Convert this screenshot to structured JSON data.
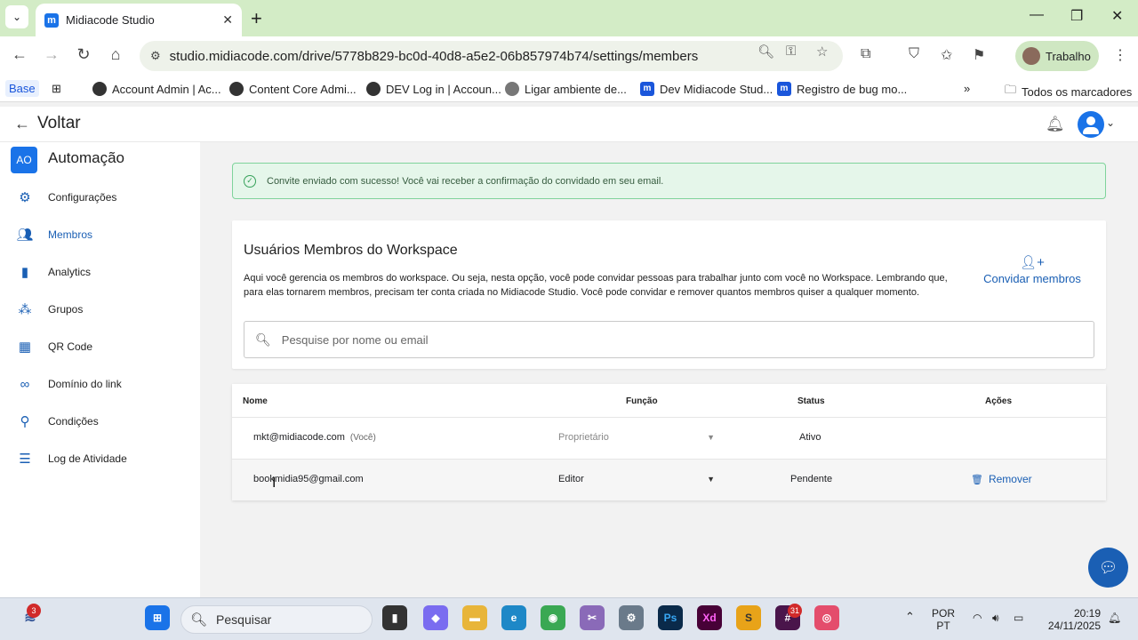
{
  "browser": {
    "tab_title": "Midiacode Studio",
    "tab_favicon": "m",
    "url": "studio.midiacode.com/drive/5778b829-bc0d-40d8-a5e2-06b857974b74/settings/members",
    "profile_label": "Trabalho",
    "bookmarks": [
      {
        "label": "Account Admin | Ac...",
        "icon": "globe-icon"
      },
      {
        "label": "Content Core Admi...",
        "icon": "globe-icon"
      },
      {
        "label": "DEV Log in | Accoun...",
        "icon": "globe-icon"
      },
      {
        "label": "Ligar ambiente de...",
        "icon": "gear-icon"
      },
      {
        "label": "Dev Midiacode Stud...",
        "icon": "midiacode-icon"
      },
      {
        "label": "Registro de bug mo...",
        "icon": "midiacode-icon"
      }
    ],
    "bookmarks_base": "Base",
    "all_bookmarks": "Todos os marcadores"
  },
  "header": {
    "back_label": "Voltar"
  },
  "sidebar": {
    "workspace_initials": "AO",
    "workspace_name": "Automação",
    "items": [
      {
        "label": "Configurações",
        "icon": "gear-icon"
      },
      {
        "label": "Membros",
        "icon": "people-icon",
        "active": true
      },
      {
        "label": "Analytics",
        "icon": "bar-chart-icon"
      },
      {
        "label": "Grupos",
        "icon": "groups-icon"
      },
      {
        "label": "QR Code",
        "icon": "qr-code-icon"
      },
      {
        "label": "Domínio do link",
        "icon": "link-icon"
      },
      {
        "label": "Condições",
        "icon": "conditions-icon"
      },
      {
        "label": "Log de Atividade",
        "icon": "list-icon"
      }
    ]
  },
  "alert": {
    "message": "Convite enviado com sucesso! Você vai receber a confirmação do convidado em seu email."
  },
  "members_card": {
    "title": "Usuários Membros do Workspace",
    "description": "Aqui você gerencia os membros do workspace. Ou seja, nesta opção, você pode convidar pessoas para trabalhar junto com você no Workspace. Lembrando que, para elas tornarem membros, precisam ter conta criada no Midiacode Studio. Você pode convidar e remover quantos membros quiser a qualquer momento.",
    "invite_label": "Convidar membros",
    "search_placeholder": "Pesquise por nome ou email",
    "search_value": ""
  },
  "table": {
    "headers": {
      "name": "Nome",
      "role": "Função",
      "status": "Status",
      "actions": "Ações"
    },
    "rows": [
      {
        "email": "mkt@midiacode.com",
        "you": "(Você)",
        "role": "Proprietário",
        "status": "Ativo",
        "action": ""
      },
      {
        "email": "bookmidia95@gmail.com",
        "you": "",
        "role": "Editor",
        "status": "Pendente",
        "action": "Remover"
      }
    ]
  },
  "taskbar": {
    "search_placeholder": "Pesquisar",
    "notification_count": "3",
    "slack_count": "31",
    "lang_top": "POR",
    "lang_bottom": "PT",
    "time": "20:19",
    "date": "24/11/2025"
  },
  "colors": {
    "accent": "#1a5fb4",
    "success_bg": "#e5f6ea",
    "success_border": "#7fd39b",
    "chrome_green": "#d3ecc6"
  }
}
